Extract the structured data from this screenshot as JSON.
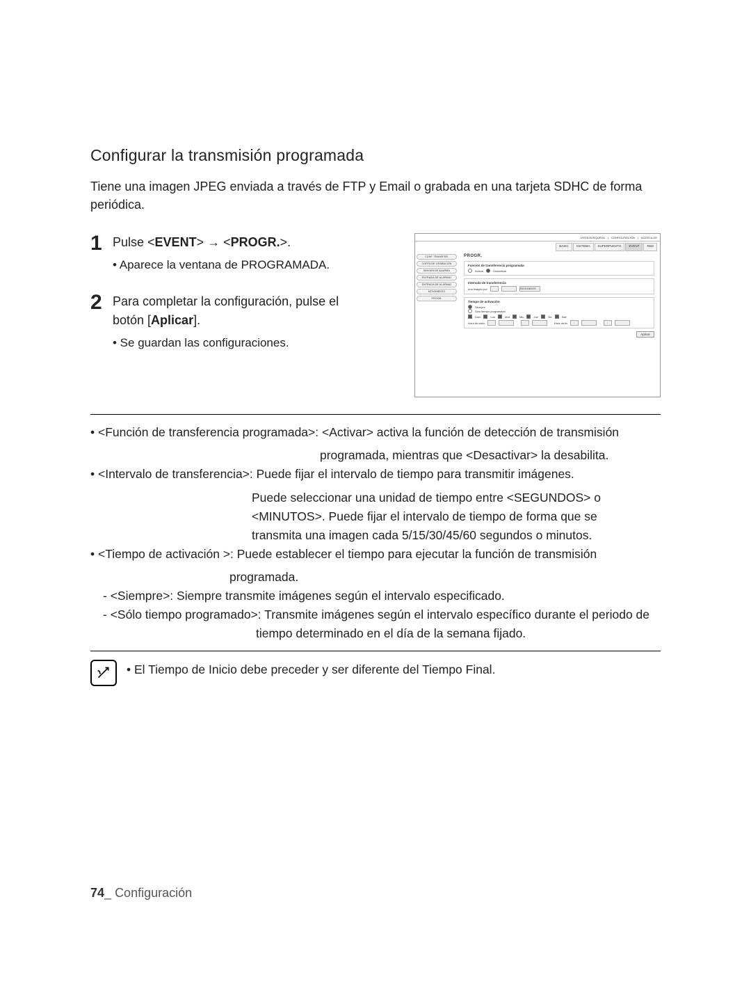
{
  "title": "Configurar la transmisión programada",
  "intro": "Tiene una imagen JPEG enviada a través de FTP y Email o grabada en una tarjeta SDHC de forma periódica.",
  "steps": {
    "s1_num": "1",
    "s1_pre": "Pulse <",
    "s1_event": "EVENT",
    "s1_mid": "> ",
    "s1_arrow": " <",
    "s1_progr": "PROGR.",
    "s1_post": ">.",
    "s1_sub": "• Aparece la ventana de PROGRAMADA.",
    "s2_num": "2",
    "s2_line1a": "Para completar la configuración, pulse el",
    "s2_line1b_pre": "botón [",
    "s2_line1b_bold": "Aplicar",
    "s2_line1b_post": "].",
    "s2_sub": "• Se guardan las configuraciones."
  },
  "shot": {
    "toplinks": [
      "VISTA BÚSQUEDA",
      "CONFIGURACIÓN",
      "ACERCA DE"
    ],
    "tabs": [
      "BASIC",
      "SISTEMA",
      "SUPERPUESTO",
      "EVENT",
      "RED"
    ],
    "active_tab": 3,
    "side": [
      "CONF. TRANSFER.",
      "CORTA DE GRABACIÓN",
      "IMAGEN DE ALARMA",
      "ENTRADA DE ALARMA1",
      "ENTRADA DE ALARMA2",
      "MOVIMIENTO",
      "PROGR."
    ],
    "heading": "PROGR.",
    "box1_title": "Función de transferencia programada",
    "radio_on": "Activar",
    "radio_off": "Desactivar",
    "box2_title": "Intervalo de transferencia",
    "interval_label": "una imagen por",
    "interval_val": "5",
    "interval_unit": "SEGUNDOS",
    "box3_title": "Tiempo de activación",
    "always": "Siempre",
    "only": "Sólo tiempo programado",
    "days": [
      "Dom",
      "Lun",
      "Mar",
      "Miu",
      "Jue",
      "Vie",
      "Sáb"
    ],
    "start_label": "Hora de inicio",
    "end_label": "Hora de fin",
    "apply": "Aplicar"
  },
  "desc": {
    "l1": "• <Función de transferencia programada>: <Activar> activa la función de detección de transmisión",
    "l1b": "programada, mientras que <Desactivar> la desabilita.",
    "l2": "• <Intervalo de transferencia>: Puede fijar el intervalo de tiempo para transmitir imágenes.",
    "l2b": "Puede seleccionar una unidad de tiempo entre <SEGUNDOS> o",
    "l2c": "<MINUTOS>. Puede fijar el intervalo de tiempo de forma que se",
    "l2d": "transmita una imagen cada 5/15/30/45/60 segundos o minutos.",
    "l3": "• <Tiempo de activación >: Puede establecer el tiempo para ejecutar la función de transmisión",
    "l3b": "programada.",
    "l4": "- <Siempre>: Siempre transmite imágenes según el intervalo especificado.",
    "l5": "- <Sólo tiempo programado>: Transmite imágenes según el intervalo específico durante el periodo de",
    "l5b": "tiempo determinado en el día de la semana fijado."
  },
  "note": "• El Tiempo de Inicio debe preceder y ser diferente del Tiempo Final.",
  "footer_page": "74",
  "footer_sep": "_",
  "footer_section": "Configuración"
}
